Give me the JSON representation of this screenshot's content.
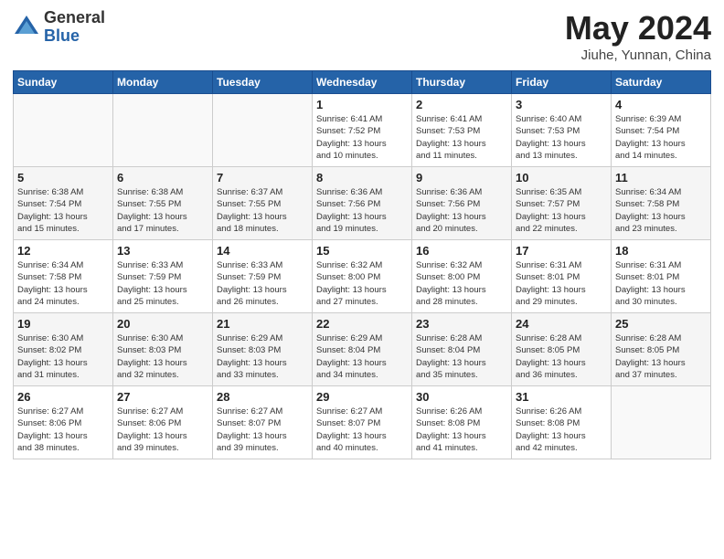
{
  "logo": {
    "general": "General",
    "blue": "Blue"
  },
  "title": "May 2024",
  "subtitle": "Jiuhe, Yunnan, China",
  "days_of_week": [
    "Sunday",
    "Monday",
    "Tuesday",
    "Wednesday",
    "Thursday",
    "Friday",
    "Saturday"
  ],
  "weeks": [
    [
      {
        "day": "",
        "info": ""
      },
      {
        "day": "",
        "info": ""
      },
      {
        "day": "",
        "info": ""
      },
      {
        "day": "1",
        "info": "Sunrise: 6:41 AM\nSunset: 7:52 PM\nDaylight: 13 hours\nand 10 minutes."
      },
      {
        "day": "2",
        "info": "Sunrise: 6:41 AM\nSunset: 7:53 PM\nDaylight: 13 hours\nand 11 minutes."
      },
      {
        "day": "3",
        "info": "Sunrise: 6:40 AM\nSunset: 7:53 PM\nDaylight: 13 hours\nand 13 minutes."
      },
      {
        "day": "4",
        "info": "Sunrise: 6:39 AM\nSunset: 7:54 PM\nDaylight: 13 hours\nand 14 minutes."
      }
    ],
    [
      {
        "day": "5",
        "info": "Sunrise: 6:38 AM\nSunset: 7:54 PM\nDaylight: 13 hours\nand 15 minutes."
      },
      {
        "day": "6",
        "info": "Sunrise: 6:38 AM\nSunset: 7:55 PM\nDaylight: 13 hours\nand 17 minutes."
      },
      {
        "day": "7",
        "info": "Sunrise: 6:37 AM\nSunset: 7:55 PM\nDaylight: 13 hours\nand 18 minutes."
      },
      {
        "day": "8",
        "info": "Sunrise: 6:36 AM\nSunset: 7:56 PM\nDaylight: 13 hours\nand 19 minutes."
      },
      {
        "day": "9",
        "info": "Sunrise: 6:36 AM\nSunset: 7:56 PM\nDaylight: 13 hours\nand 20 minutes."
      },
      {
        "day": "10",
        "info": "Sunrise: 6:35 AM\nSunset: 7:57 PM\nDaylight: 13 hours\nand 22 minutes."
      },
      {
        "day": "11",
        "info": "Sunrise: 6:34 AM\nSunset: 7:58 PM\nDaylight: 13 hours\nand 23 minutes."
      }
    ],
    [
      {
        "day": "12",
        "info": "Sunrise: 6:34 AM\nSunset: 7:58 PM\nDaylight: 13 hours\nand 24 minutes."
      },
      {
        "day": "13",
        "info": "Sunrise: 6:33 AM\nSunset: 7:59 PM\nDaylight: 13 hours\nand 25 minutes."
      },
      {
        "day": "14",
        "info": "Sunrise: 6:33 AM\nSunset: 7:59 PM\nDaylight: 13 hours\nand 26 minutes."
      },
      {
        "day": "15",
        "info": "Sunrise: 6:32 AM\nSunset: 8:00 PM\nDaylight: 13 hours\nand 27 minutes."
      },
      {
        "day": "16",
        "info": "Sunrise: 6:32 AM\nSunset: 8:00 PM\nDaylight: 13 hours\nand 28 minutes."
      },
      {
        "day": "17",
        "info": "Sunrise: 6:31 AM\nSunset: 8:01 PM\nDaylight: 13 hours\nand 29 minutes."
      },
      {
        "day": "18",
        "info": "Sunrise: 6:31 AM\nSunset: 8:01 PM\nDaylight: 13 hours\nand 30 minutes."
      }
    ],
    [
      {
        "day": "19",
        "info": "Sunrise: 6:30 AM\nSunset: 8:02 PM\nDaylight: 13 hours\nand 31 minutes."
      },
      {
        "day": "20",
        "info": "Sunrise: 6:30 AM\nSunset: 8:03 PM\nDaylight: 13 hours\nand 32 minutes."
      },
      {
        "day": "21",
        "info": "Sunrise: 6:29 AM\nSunset: 8:03 PM\nDaylight: 13 hours\nand 33 minutes."
      },
      {
        "day": "22",
        "info": "Sunrise: 6:29 AM\nSunset: 8:04 PM\nDaylight: 13 hours\nand 34 minutes."
      },
      {
        "day": "23",
        "info": "Sunrise: 6:28 AM\nSunset: 8:04 PM\nDaylight: 13 hours\nand 35 minutes."
      },
      {
        "day": "24",
        "info": "Sunrise: 6:28 AM\nSunset: 8:05 PM\nDaylight: 13 hours\nand 36 minutes."
      },
      {
        "day": "25",
        "info": "Sunrise: 6:28 AM\nSunset: 8:05 PM\nDaylight: 13 hours\nand 37 minutes."
      }
    ],
    [
      {
        "day": "26",
        "info": "Sunrise: 6:27 AM\nSunset: 8:06 PM\nDaylight: 13 hours\nand 38 minutes."
      },
      {
        "day": "27",
        "info": "Sunrise: 6:27 AM\nSunset: 8:06 PM\nDaylight: 13 hours\nand 39 minutes."
      },
      {
        "day": "28",
        "info": "Sunrise: 6:27 AM\nSunset: 8:07 PM\nDaylight: 13 hours\nand 39 minutes."
      },
      {
        "day": "29",
        "info": "Sunrise: 6:27 AM\nSunset: 8:07 PM\nDaylight: 13 hours\nand 40 minutes."
      },
      {
        "day": "30",
        "info": "Sunrise: 6:26 AM\nSunset: 8:08 PM\nDaylight: 13 hours\nand 41 minutes."
      },
      {
        "day": "31",
        "info": "Sunrise: 6:26 AM\nSunset: 8:08 PM\nDaylight: 13 hours\nand 42 minutes."
      },
      {
        "day": "",
        "info": ""
      }
    ]
  ]
}
